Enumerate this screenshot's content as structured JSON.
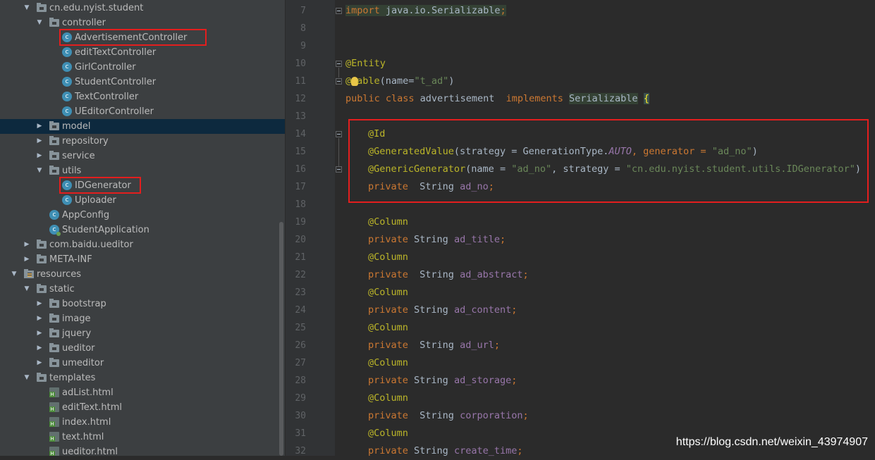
{
  "colors": {
    "highlight_box": "#e31e1e",
    "selected_row": "#0d293e",
    "sidebar_bg": "#3c3f41",
    "editor_bg": "#2b2b2b"
  },
  "tree": [
    {
      "label": "cn.edu.nyist.student",
      "icon": "folder-icon",
      "expanded": true
    },
    {
      "label": "controller",
      "icon": "folder-icon",
      "expanded": true
    },
    {
      "label": "AdvertisementController",
      "icon": "class-icon",
      "highlighted": true
    },
    {
      "label": "editTextController",
      "icon": "class-icon"
    },
    {
      "label": "GirlController",
      "icon": "class-icon"
    },
    {
      "label": "StudentController",
      "icon": "class-icon"
    },
    {
      "label": "TextController",
      "icon": "class-icon"
    },
    {
      "label": "UEditorController",
      "icon": "class-icon"
    },
    {
      "label": "model",
      "icon": "folder-icon",
      "expanded": false,
      "selected": true
    },
    {
      "label": "repository",
      "icon": "folder-icon",
      "expanded": false
    },
    {
      "label": "service",
      "icon": "folder-icon",
      "expanded": false
    },
    {
      "label": "utils",
      "icon": "folder-icon",
      "expanded": true
    },
    {
      "label": "IDGenerator",
      "icon": "class-icon",
      "highlighted": true
    },
    {
      "label": "Uploader",
      "icon": "class-icon"
    },
    {
      "label": "AppConfig",
      "icon": "class-icon"
    },
    {
      "label": "StudentApplication",
      "icon": "spring-boot-class-icon"
    },
    {
      "label": "com.baidu.ueditor",
      "icon": "folder-icon",
      "expanded": false
    },
    {
      "label": "META-INF",
      "icon": "folder-icon",
      "expanded": false
    },
    {
      "label": "resources",
      "icon": "resources-folder-icon",
      "expanded": true
    },
    {
      "label": "static",
      "icon": "folder-icon",
      "expanded": true
    },
    {
      "label": "bootstrap",
      "icon": "folder-icon",
      "expanded": false
    },
    {
      "label": "image",
      "icon": "folder-icon",
      "expanded": false
    },
    {
      "label": "jquery",
      "icon": "folder-icon",
      "expanded": false
    },
    {
      "label": "ueditor",
      "icon": "folder-icon",
      "expanded": false
    },
    {
      "label": "umeditor",
      "icon": "folder-icon",
      "expanded": false
    },
    {
      "label": "templates",
      "icon": "folder-icon",
      "expanded": true
    },
    {
      "label": "adList.html",
      "icon": "html-file-icon"
    },
    {
      "label": "editText.html",
      "icon": "html-file-icon"
    },
    {
      "label": "index.html",
      "icon": "html-file-icon"
    },
    {
      "label": "text.html",
      "icon": "html-file-icon"
    },
    {
      "label": "ueditor.html",
      "icon": "html-file-icon"
    }
  ],
  "line_numbers": [
    "7",
    "8",
    "9",
    "10",
    "11",
    "12",
    "13",
    "14",
    "15",
    "16",
    "17",
    "18",
    "19",
    "20",
    "21",
    "22",
    "23",
    "24",
    "25",
    "26",
    "27",
    "28",
    "29",
    "30",
    "31",
    "32"
  ],
  "code": {
    "l7_kw": "import",
    "l7_pkg": " java.io.",
    "l7_cls": "Serializable",
    "l7_semi": ";",
    "l10": "@Entity",
    "l11_a": "@",
    "l11_b": "able",
    "l11_c": "(name=",
    "l11_d": "\"t_ad\"",
    "l11_e": ")",
    "l12_kw1": "public class",
    "l12_name": " advertisement  ",
    "l12_kw2": "implements",
    "l12_sp": " ",
    "l12_iface": "Serializable",
    "l12_sp2": " ",
    "l12_brace": "{",
    "l14": "@Id",
    "l15_an": "@GeneratedValue",
    "l15_a": "(strategy = GenerationType.",
    "l15_en": "AUTO",
    "l15_b": ", generator = ",
    "l15_st": "\"ad_no\"",
    "l15_c": ")",
    "l16_an": "@GenericGenerator",
    "l16_a": "(name = ",
    "l16_st1": "\"ad_no\"",
    "l16_b": ", strategy = ",
    "l16_st2": "\"cn.edu.nyist.student.utils.IDGenerator\"",
    "l16_c": ")",
    "l17_kw": "private",
    "l17_ty": "  String ",
    "l17_fd": "ad_no",
    "l17_semi": ";",
    "col": "@Column",
    "priv": "private",
    "l20_ty": " String ",
    "l20_fd": "ad_title",
    "l22_ty": "  String ",
    "l22_fd": "ad_abstract",
    "l24_ty": " String ",
    "l24_fd": "ad_content",
    "l26_ty": "  String ",
    "l26_fd": "ad_url",
    "l28_ty": " String ",
    "l28_fd": "ad_storage",
    "l30_ty": "  String ",
    "l30_fd": "corporation",
    "l32_ty": " String ",
    "l32_fd": "create_time",
    "semi": ";"
  },
  "watermark": "https://blog.csdn.net/weixin_43974907"
}
